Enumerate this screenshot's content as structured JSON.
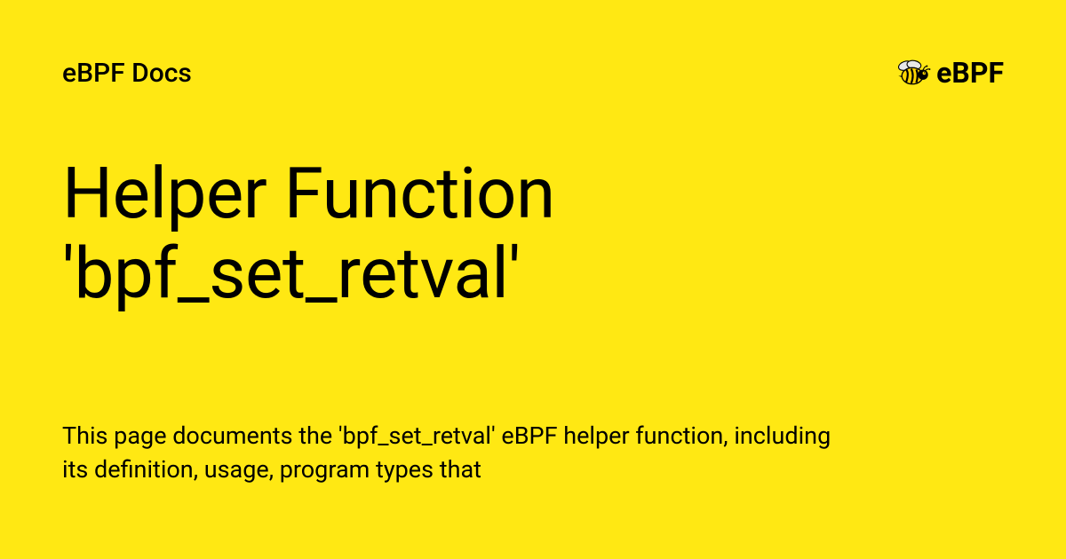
{
  "header": {
    "site_name": "eBPF Docs",
    "logo_text": "eBPF"
  },
  "page_title": "Helper Function 'bpf_set_retval'",
  "description": "This page documents the 'bpf_set_retval' eBPF helper function, including its definition, usage, program types that"
}
